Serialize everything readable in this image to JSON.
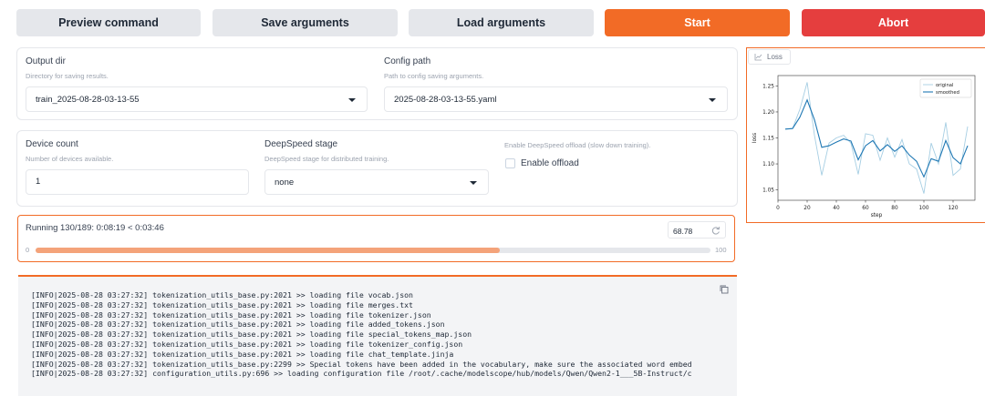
{
  "toolbar": {
    "preview_label": "Preview command",
    "save_label": "Save arguments",
    "load_label": "Load arguments",
    "start_label": "Start",
    "abort_label": "Abort"
  },
  "output_dir": {
    "label": "Output dir",
    "info": "Directory for saving results.",
    "value": "train_2025-08-28-03-13-55"
  },
  "config_path": {
    "label": "Config path",
    "info": "Path to config saving arguments.",
    "value": "2025-08-28-03-13-55.yaml"
  },
  "device_count": {
    "label": "Device count",
    "info": "Number of devices available.",
    "value": "1"
  },
  "deepspeed_stage": {
    "label": "DeepSpeed stage",
    "info": "DeepSpeed stage for distributed training.",
    "value": "none"
  },
  "offload": {
    "info": "Enable DeepSpeed offload (slow down training).",
    "label": "Enable offload",
    "checked": false
  },
  "progress": {
    "status": "Running 130/189: 0:08:19 < 0:03:46",
    "slider_value": "68.78",
    "min_label": "0",
    "max_label": "100",
    "fraction": 0.6878
  },
  "log": {
    "lines": [
      "[INFO|2025-08-28 03:27:32] tokenization_utils_base.py:2021 >> loading file vocab.json",
      "[INFO|2025-08-28 03:27:32] tokenization_utils_base.py:2021 >> loading file merges.txt",
      "[INFO|2025-08-28 03:27:32] tokenization_utils_base.py:2021 >> loading file tokenizer.json",
      "[INFO|2025-08-28 03:27:32] tokenization_utils_base.py:2021 >> loading file added_tokens.json",
      "[INFO|2025-08-28 03:27:32] tokenization_utils_base.py:2021 >> loading file special_tokens_map.json",
      "[INFO|2025-08-28 03:27:32] tokenization_utils_base.py:2021 >> loading file tokenizer_config.json",
      "[INFO|2025-08-28 03:27:32] tokenization_utils_base.py:2021 >> loading file chat_template.jinja",
      "[INFO|2025-08-28 03:27:32] tokenization_utils_base.py:2299 >> Special tokens have been added in the vocabulary, make sure the associated word embed",
      "[INFO|2025-08-28 03:27:32] configuration_utils.py:696 >> loading configuration file /root/.cache/modelscope/hub/models/Qwen/Qwen2-1___5B-Instruct/c"
    ]
  },
  "chart_tab": {
    "label": "Loss"
  },
  "icons": {
    "caret": "chevron-down-icon",
    "reset": "reset-icon",
    "copy": "copy-icon",
    "chart": "chart-icon"
  },
  "colors": {
    "accent": "#f26b26",
    "abort": "#e53e3e",
    "original_series": "#a6cee3",
    "smoothed_series": "#1f78b4"
  },
  "chart_data": {
    "type": "line",
    "title": "",
    "xlabel": "step",
    "ylabel": "loss",
    "xlim": [
      0,
      135
    ],
    "ylim": [
      1.03,
      1.27
    ],
    "xticks": [
      0,
      20,
      40,
      60,
      80,
      100,
      120
    ],
    "yticks": [
      1.05,
      1.1,
      1.15,
      1.2,
      1.25
    ],
    "grid": false,
    "legend": "top-right",
    "series": [
      {
        "name": "original",
        "x": [
          5,
          10,
          15,
          20,
          25,
          30,
          35,
          40,
          45,
          50,
          55,
          60,
          65,
          70,
          75,
          80,
          85,
          90,
          95,
          100,
          105,
          110,
          115,
          120,
          125,
          130
        ],
        "y": [
          1.167,
          1.168,
          1.205,
          1.257,
          1.155,
          1.078,
          1.14,
          1.15,
          1.155,
          1.14,
          1.08,
          1.158,
          1.155,
          1.107,
          1.15,
          1.113,
          1.147,
          1.1,
          1.09,
          1.043,
          1.14,
          1.1,
          1.18,
          1.078,
          1.09,
          1.172
        ]
      },
      {
        "name": "smoothed",
        "x": [
          5,
          10,
          15,
          20,
          25,
          30,
          35,
          40,
          45,
          50,
          55,
          60,
          65,
          70,
          75,
          80,
          85,
          90,
          95,
          100,
          105,
          110,
          115,
          120,
          125,
          130
        ],
        "y": [
          1.167,
          1.168,
          1.19,
          1.223,
          1.185,
          1.132,
          1.135,
          1.142,
          1.148,
          1.144,
          1.108,
          1.135,
          1.145,
          1.125,
          1.137,
          1.124,
          1.135,
          1.117,
          1.105,
          1.075,
          1.11,
          1.105,
          1.145,
          1.112,
          1.1,
          1.135
        ]
      }
    ]
  }
}
